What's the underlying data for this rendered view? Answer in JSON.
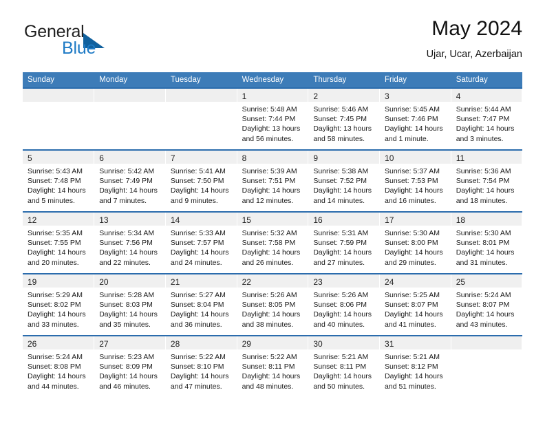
{
  "brand": {
    "name_part1": "General",
    "name_part2": "Blue",
    "triangle_color": "#11619e",
    "blue_text_color": "#1e7ac5"
  },
  "header": {
    "title": "May 2024",
    "subtitle": "Ujar, Ucar, Azerbaijan"
  },
  "theme": {
    "header_bg": "#3d7cb8",
    "row_divider": "#2b6cad",
    "daynum_band": "#f0f0f0"
  },
  "weekdays": [
    "Sunday",
    "Monday",
    "Tuesday",
    "Wednesday",
    "Thursday",
    "Friday",
    "Saturday"
  ],
  "labels": {
    "sunrise_prefix": "Sunrise:",
    "sunset_prefix": "Sunset:",
    "daylight_prefix": "Daylight:"
  },
  "weeks": [
    [
      {
        "day": "",
        "sunrise": "",
        "sunset": "",
        "daylight_l1": "",
        "daylight_l2": ""
      },
      {
        "day": "",
        "sunrise": "",
        "sunset": "",
        "daylight_l1": "",
        "daylight_l2": ""
      },
      {
        "day": "",
        "sunrise": "",
        "sunset": "",
        "daylight_l1": "",
        "daylight_l2": ""
      },
      {
        "day": "1",
        "sunrise": "Sunrise: 5:48 AM",
        "sunset": "Sunset: 7:44 PM",
        "daylight_l1": "Daylight: 13 hours",
        "daylight_l2": "and 56 minutes."
      },
      {
        "day": "2",
        "sunrise": "Sunrise: 5:46 AM",
        "sunset": "Sunset: 7:45 PM",
        "daylight_l1": "Daylight: 13 hours",
        "daylight_l2": "and 58 minutes."
      },
      {
        "day": "3",
        "sunrise": "Sunrise: 5:45 AM",
        "sunset": "Sunset: 7:46 PM",
        "daylight_l1": "Daylight: 14 hours",
        "daylight_l2": "and 1 minute."
      },
      {
        "day": "4",
        "sunrise": "Sunrise: 5:44 AM",
        "sunset": "Sunset: 7:47 PM",
        "daylight_l1": "Daylight: 14 hours",
        "daylight_l2": "and 3 minutes."
      }
    ],
    [
      {
        "day": "5",
        "sunrise": "Sunrise: 5:43 AM",
        "sunset": "Sunset: 7:48 PM",
        "daylight_l1": "Daylight: 14 hours",
        "daylight_l2": "and 5 minutes."
      },
      {
        "day": "6",
        "sunrise": "Sunrise: 5:42 AM",
        "sunset": "Sunset: 7:49 PM",
        "daylight_l1": "Daylight: 14 hours",
        "daylight_l2": "and 7 minutes."
      },
      {
        "day": "7",
        "sunrise": "Sunrise: 5:41 AM",
        "sunset": "Sunset: 7:50 PM",
        "daylight_l1": "Daylight: 14 hours",
        "daylight_l2": "and 9 minutes."
      },
      {
        "day": "8",
        "sunrise": "Sunrise: 5:39 AM",
        "sunset": "Sunset: 7:51 PM",
        "daylight_l1": "Daylight: 14 hours",
        "daylight_l2": "and 12 minutes."
      },
      {
        "day": "9",
        "sunrise": "Sunrise: 5:38 AM",
        "sunset": "Sunset: 7:52 PM",
        "daylight_l1": "Daylight: 14 hours",
        "daylight_l2": "and 14 minutes."
      },
      {
        "day": "10",
        "sunrise": "Sunrise: 5:37 AM",
        "sunset": "Sunset: 7:53 PM",
        "daylight_l1": "Daylight: 14 hours",
        "daylight_l2": "and 16 minutes."
      },
      {
        "day": "11",
        "sunrise": "Sunrise: 5:36 AM",
        "sunset": "Sunset: 7:54 PM",
        "daylight_l1": "Daylight: 14 hours",
        "daylight_l2": "and 18 minutes."
      }
    ],
    [
      {
        "day": "12",
        "sunrise": "Sunrise: 5:35 AM",
        "sunset": "Sunset: 7:55 PM",
        "daylight_l1": "Daylight: 14 hours",
        "daylight_l2": "and 20 minutes."
      },
      {
        "day": "13",
        "sunrise": "Sunrise: 5:34 AM",
        "sunset": "Sunset: 7:56 PM",
        "daylight_l1": "Daylight: 14 hours",
        "daylight_l2": "and 22 minutes."
      },
      {
        "day": "14",
        "sunrise": "Sunrise: 5:33 AM",
        "sunset": "Sunset: 7:57 PM",
        "daylight_l1": "Daylight: 14 hours",
        "daylight_l2": "and 24 minutes."
      },
      {
        "day": "15",
        "sunrise": "Sunrise: 5:32 AM",
        "sunset": "Sunset: 7:58 PM",
        "daylight_l1": "Daylight: 14 hours",
        "daylight_l2": "and 26 minutes."
      },
      {
        "day": "16",
        "sunrise": "Sunrise: 5:31 AM",
        "sunset": "Sunset: 7:59 PM",
        "daylight_l1": "Daylight: 14 hours",
        "daylight_l2": "and 27 minutes."
      },
      {
        "day": "17",
        "sunrise": "Sunrise: 5:30 AM",
        "sunset": "Sunset: 8:00 PM",
        "daylight_l1": "Daylight: 14 hours",
        "daylight_l2": "and 29 minutes."
      },
      {
        "day": "18",
        "sunrise": "Sunrise: 5:30 AM",
        "sunset": "Sunset: 8:01 PM",
        "daylight_l1": "Daylight: 14 hours",
        "daylight_l2": "and 31 minutes."
      }
    ],
    [
      {
        "day": "19",
        "sunrise": "Sunrise: 5:29 AM",
        "sunset": "Sunset: 8:02 PM",
        "daylight_l1": "Daylight: 14 hours",
        "daylight_l2": "and 33 minutes."
      },
      {
        "day": "20",
        "sunrise": "Sunrise: 5:28 AM",
        "sunset": "Sunset: 8:03 PM",
        "daylight_l1": "Daylight: 14 hours",
        "daylight_l2": "and 35 minutes."
      },
      {
        "day": "21",
        "sunrise": "Sunrise: 5:27 AM",
        "sunset": "Sunset: 8:04 PM",
        "daylight_l1": "Daylight: 14 hours",
        "daylight_l2": "and 36 minutes."
      },
      {
        "day": "22",
        "sunrise": "Sunrise: 5:26 AM",
        "sunset": "Sunset: 8:05 PM",
        "daylight_l1": "Daylight: 14 hours",
        "daylight_l2": "and 38 minutes."
      },
      {
        "day": "23",
        "sunrise": "Sunrise: 5:26 AM",
        "sunset": "Sunset: 8:06 PM",
        "daylight_l1": "Daylight: 14 hours",
        "daylight_l2": "and 40 minutes."
      },
      {
        "day": "24",
        "sunrise": "Sunrise: 5:25 AM",
        "sunset": "Sunset: 8:07 PM",
        "daylight_l1": "Daylight: 14 hours",
        "daylight_l2": "and 41 minutes."
      },
      {
        "day": "25",
        "sunrise": "Sunrise: 5:24 AM",
        "sunset": "Sunset: 8:07 PM",
        "daylight_l1": "Daylight: 14 hours",
        "daylight_l2": "and 43 minutes."
      }
    ],
    [
      {
        "day": "26",
        "sunrise": "Sunrise: 5:24 AM",
        "sunset": "Sunset: 8:08 PM",
        "daylight_l1": "Daylight: 14 hours",
        "daylight_l2": "and 44 minutes."
      },
      {
        "day": "27",
        "sunrise": "Sunrise: 5:23 AM",
        "sunset": "Sunset: 8:09 PM",
        "daylight_l1": "Daylight: 14 hours",
        "daylight_l2": "and 46 minutes."
      },
      {
        "day": "28",
        "sunrise": "Sunrise: 5:22 AM",
        "sunset": "Sunset: 8:10 PM",
        "daylight_l1": "Daylight: 14 hours",
        "daylight_l2": "and 47 minutes."
      },
      {
        "day": "29",
        "sunrise": "Sunrise: 5:22 AM",
        "sunset": "Sunset: 8:11 PM",
        "daylight_l1": "Daylight: 14 hours",
        "daylight_l2": "and 48 minutes."
      },
      {
        "day": "30",
        "sunrise": "Sunrise: 5:21 AM",
        "sunset": "Sunset: 8:11 PM",
        "daylight_l1": "Daylight: 14 hours",
        "daylight_l2": "and 50 minutes."
      },
      {
        "day": "31",
        "sunrise": "Sunrise: 5:21 AM",
        "sunset": "Sunset: 8:12 PM",
        "daylight_l1": "Daylight: 14 hours",
        "daylight_l2": "and 51 minutes."
      },
      {
        "day": "",
        "sunrise": "",
        "sunset": "",
        "daylight_l1": "",
        "daylight_l2": ""
      }
    ]
  ]
}
